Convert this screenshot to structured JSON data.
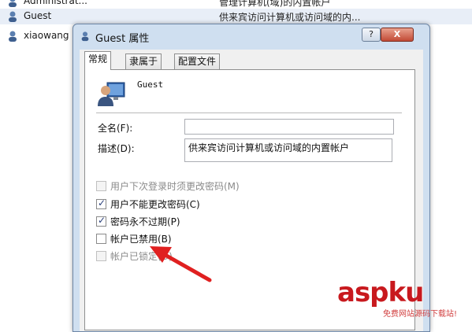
{
  "users_list": {
    "rows": [
      {
        "name": "Administrat...",
        "description": "管理计算机(域)的内置帐户"
      },
      {
        "name": "Guest",
        "description": "供来宾访问计算机或访问域的内..."
      },
      {
        "name": "xiaowang",
        "description": ""
      }
    ]
  },
  "dialog": {
    "title": "Guest 属性",
    "help_label": "?",
    "close_label": "X",
    "tabs": [
      {
        "label": "常规"
      },
      {
        "label": "隶属于"
      },
      {
        "label": "配置文件"
      }
    ],
    "user_name": "Guest",
    "fullname_label": "全名(F):",
    "fullname_value": "",
    "description_label": "描述(D):",
    "description_value": "供来宾访问计算机或访问域的内置帐户",
    "checkboxes": [
      {
        "label": "用户下次登录时须更改密码(M)",
        "checked": false,
        "disabled": true
      },
      {
        "label": "用户不能更改密码(C)",
        "checked": true,
        "disabled": false
      },
      {
        "label": "密码永不过期(P)",
        "checked": true,
        "disabled": false
      },
      {
        "label": "帐户已禁用(B)",
        "checked": false,
        "disabled": false
      },
      {
        "label": "帐户已锁定(O)",
        "checked": false,
        "disabled": true
      }
    ]
  },
  "watermark": {
    "logo": "aspku",
    "sub": "免费网站源码下载站!"
  },
  "colors": {
    "arrow": "#e02020",
    "accent": "#c8191e"
  }
}
